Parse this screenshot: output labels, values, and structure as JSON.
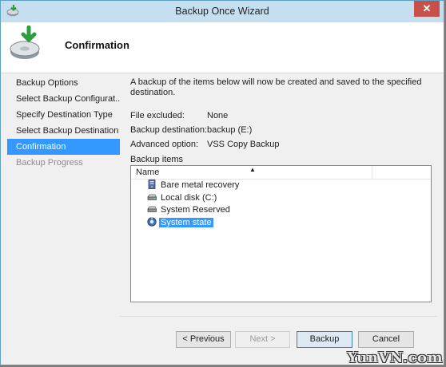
{
  "window": {
    "title": "Backup Once Wizard",
    "close_glyph": "✕",
    "icons": {
      "system": "backup-app-icon",
      "header": "backup-wizard-icon",
      "close": "close-icon"
    }
  },
  "header": {
    "title": "Confirmation"
  },
  "nav": {
    "items": [
      {
        "label": "Backup Options",
        "state": "normal"
      },
      {
        "label": "Select Backup Configurat...",
        "state": "normal"
      },
      {
        "label": "Specify Destination Type",
        "state": "normal"
      },
      {
        "label": "Select Backup Destination",
        "state": "normal"
      },
      {
        "label": "Confirmation",
        "state": "selected"
      },
      {
        "label": "Backup Progress",
        "state": "disabled"
      }
    ]
  },
  "content": {
    "intro": "A backup of the items below will now be created and saved to the specified destination.",
    "info": [
      {
        "label": "File excluded:",
        "value": "None"
      },
      {
        "label": "Backup destination:",
        "value": "backup (E:)"
      },
      {
        "label": "Advanced option:",
        "value": "VSS Copy Backup"
      }
    ],
    "items_label": "Backup items"
  },
  "list": {
    "column_name": "Name",
    "sort_glyph": "▲",
    "rows": [
      {
        "label": "Bare metal recovery",
        "icon": "server-icon",
        "selected": false
      },
      {
        "label": "Local disk (C:)",
        "icon": "drive-icon",
        "selected": false
      },
      {
        "label": "System Reserved",
        "icon": "drive-icon",
        "selected": false
      },
      {
        "label": "System state",
        "icon": "system-state-icon",
        "selected": true
      }
    ]
  },
  "buttons": {
    "previous": "< Previous",
    "next": "Next >",
    "backup": "Backup",
    "cancel": "Cancel"
  },
  "watermark": "YunVN.com",
  "colors": {
    "selection": "#3399ff",
    "titlebar": "#c6dff0",
    "close": "#c7504a"
  }
}
